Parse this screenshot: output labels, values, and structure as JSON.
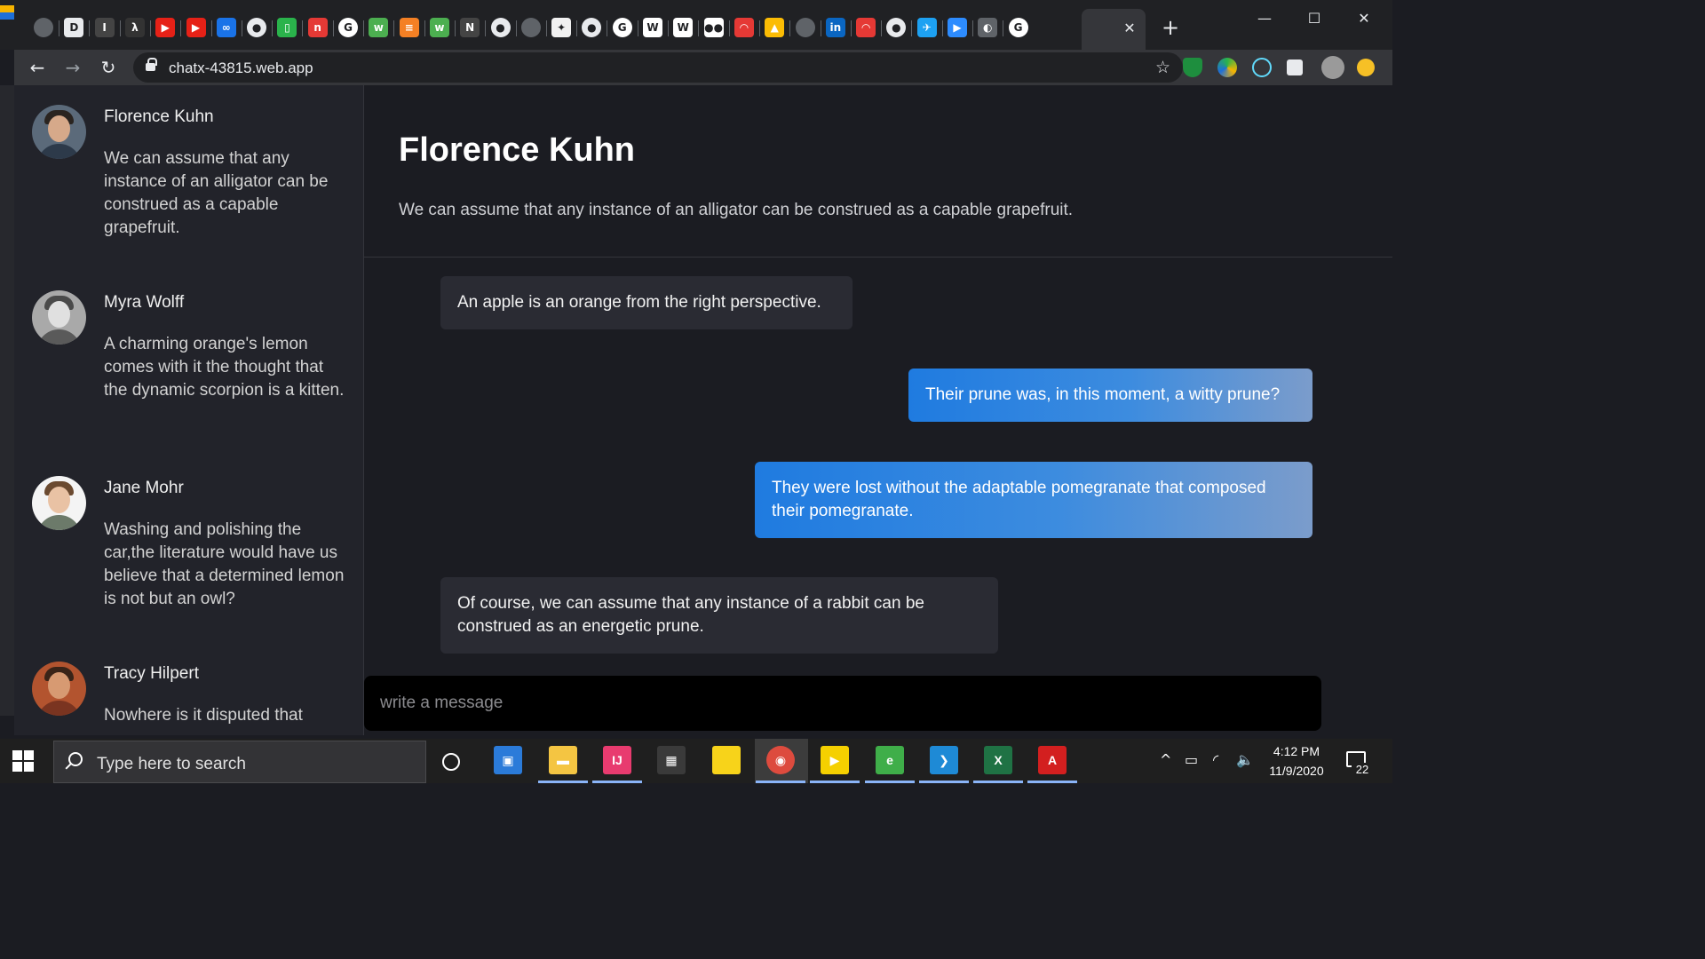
{
  "browser": {
    "url": "chatx-43815.web.app",
    "tab_close_glyph": "✕",
    "new_tab_glyph": "+",
    "window_controls": [
      "—",
      "☐",
      "✕"
    ],
    "nav": {
      "back": "←",
      "forward": "→",
      "reload": "↻"
    },
    "bookmark_glyph": "☆",
    "tab_favicons": [
      {
        "icon": "globe-icon",
        "color": "#5f6368",
        "glyph": ""
      },
      {
        "icon": "dev-icon",
        "color": "#e8eaed",
        "glyph": "D"
      },
      {
        "icon": "typewriter-icon",
        "color": "#444",
        "glyph": "I"
      },
      {
        "icon": "code-icon",
        "color": "#333",
        "glyph": "λ"
      },
      {
        "icon": "youtube-icon",
        "color": "#e62117",
        "glyph": "▶"
      },
      {
        "icon": "youtube-icon",
        "color": "#e62117",
        "glyph": "▶"
      },
      {
        "icon": "link-icon",
        "color": "#1a73e8",
        "glyph": "∞"
      },
      {
        "icon": "github-icon",
        "color": "#e8eaed",
        "glyph": "●"
      },
      {
        "icon": "notes-icon",
        "color": "#2ab34b",
        "glyph": "▯"
      },
      {
        "icon": "news-icon",
        "color": "#e53935",
        "glyph": "n"
      },
      {
        "icon": "google-icon",
        "color": "#ffffff",
        "glyph": "G"
      },
      {
        "icon": "w3-icon",
        "color": "#4caf50",
        "glyph": "w"
      },
      {
        "icon": "stackoverflow-icon",
        "color": "#f48024",
        "glyph": "≡"
      },
      {
        "icon": "w3-icon",
        "color": "#4caf50",
        "glyph": "w"
      },
      {
        "icon": "netlify-icon",
        "color": "#444",
        "glyph": "N"
      },
      {
        "icon": "github-icon",
        "color": "#e8eaed",
        "glyph": "●"
      },
      {
        "icon": "globe-icon",
        "color": "#5f6368",
        "glyph": ""
      },
      {
        "icon": "puzzle-icon",
        "color": "#f1f1f1",
        "glyph": "✦"
      },
      {
        "icon": "github-icon",
        "color": "#e8eaed",
        "glyph": "●"
      },
      {
        "icon": "google-icon",
        "color": "#ffffff",
        "glyph": "G"
      },
      {
        "icon": "wikipedia-icon",
        "color": "#ffffff",
        "glyph": "W"
      },
      {
        "icon": "nyt-icon",
        "color": "#ffffff",
        "glyph": "W"
      },
      {
        "icon": "medium-icon",
        "color": "#ffffff",
        "glyph": "●●"
      },
      {
        "icon": "arc-icon",
        "color": "#e53935",
        "glyph": "◠"
      },
      {
        "icon": "drive-icon",
        "color": "#fbbc04",
        "glyph": "▲"
      },
      {
        "icon": "globe-icon",
        "color": "#5f6368",
        "glyph": ""
      },
      {
        "icon": "linkedin-icon",
        "color": "#0a66c2",
        "glyph": "in"
      },
      {
        "icon": "arc-icon",
        "color": "#e53935",
        "glyph": "◠"
      },
      {
        "icon": "github-icon",
        "color": "#e8eaed",
        "glyph": "●"
      },
      {
        "icon": "twitter-icon",
        "color": "#1da1f2",
        "glyph": "✈"
      },
      {
        "icon": "zoom-icon",
        "color": "#2d8cff",
        "glyph": "▶"
      },
      {
        "icon": "shield-icon",
        "color": "#5f6368",
        "glyph": "◐"
      },
      {
        "icon": "google-icon",
        "color": "#ffffff",
        "glyph": "G"
      }
    ]
  },
  "sidebar": {
    "contacts": [
      {
        "name": "Florence Kuhn",
        "preview": "We can assume that any instance of an alligator can be construed as a capable grapefruit."
      },
      {
        "name": "Myra Wolff",
        "preview": "A charming orange's lemon comes with it the thought that the dynamic scorpion is a kitten."
      },
      {
        "name": "Jane Mohr",
        "preview": "Washing and polishing the car,the literature would have us believe that a determined lemon is not but an owl?"
      },
      {
        "name": "Tracy Hilpert",
        "preview": "Nowhere is it disputed that"
      }
    ]
  },
  "chat": {
    "title": "Florence Kuhn",
    "subtitle": "We can assume that any instance of an alligator can be construed as a capable grapefruit.",
    "messages": [
      {
        "direction": "in",
        "text": "An apple is an orange from the right perspective."
      },
      {
        "direction": "out",
        "text": "Their prune was, in this moment, a witty prune?"
      },
      {
        "direction": "out",
        "text": "They were lost without the adaptable pomegranate that composed their pomegranate."
      },
      {
        "direction": "in",
        "text": "Of course, we can assume that any instance of a rabbit can be construed as an energetic prune."
      }
    ],
    "composer_placeholder": "write a message"
  },
  "taskbar": {
    "search_placeholder": "Type here to search",
    "apps": [
      {
        "icon": "task-view-icon",
        "color": "#2b7bd9",
        "glyph": "▣"
      },
      {
        "icon": "file-explorer-icon",
        "color": "#f4c542",
        "glyph": "▬"
      },
      {
        "icon": "intellij-icon",
        "color": "#e83b6f",
        "glyph": "IJ"
      },
      {
        "icon": "store-icon",
        "color": "#3a3a3a",
        "glyph": "▦"
      },
      {
        "icon": "sticky-notes-icon",
        "color": "#f7d31a",
        "glyph": ""
      },
      {
        "icon": "chrome-icon",
        "color": "#dd4b3e",
        "glyph": "◉"
      },
      {
        "icon": "player-icon",
        "color": "#f5d000",
        "glyph": "▶"
      },
      {
        "icon": "edge-icon",
        "color": "#3fae49",
        "glyph": "e"
      },
      {
        "icon": "vscode-icon",
        "color": "#1e8ad6",
        "glyph": "❯"
      },
      {
        "icon": "excel-icon",
        "color": "#1f7244",
        "glyph": "X"
      },
      {
        "icon": "acrobat-icon",
        "color": "#d31f1f",
        "glyph": "A"
      }
    ],
    "time": "4:12 PM",
    "date": "11/9/2020",
    "notification_count": "22",
    "tray_up_glyph": "^",
    "battery_glyph": "▭",
    "wifi_glyph": "◜",
    "volume_glyph": "🔈"
  }
}
